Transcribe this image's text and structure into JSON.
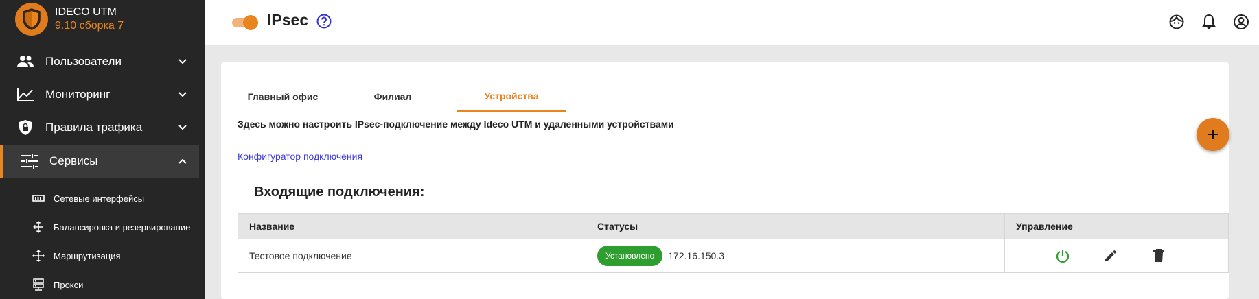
{
  "brand": {
    "name": "IDECO UTM",
    "version": "9.10 сборка 7",
    "accent": "#e8851f"
  },
  "sidebar": {
    "items": [
      {
        "label": "Пользователи",
        "icon": "users-icon",
        "expanded": false
      },
      {
        "label": "Мониторинг",
        "icon": "chart-line-icon",
        "expanded": false
      },
      {
        "label": "Правила трафика",
        "icon": "shield-lock-icon",
        "expanded": false
      },
      {
        "label": "Сервисы",
        "icon": "tune-icon",
        "expanded": true,
        "active": true
      }
    ],
    "subitems": [
      {
        "label": "Сетевые интерфейсы",
        "icon": "network-card-icon"
      },
      {
        "label": "Балансировка и резервирование",
        "icon": "arrows-split-icon"
      },
      {
        "label": "Маршрутизация",
        "icon": "arrows-move-icon"
      },
      {
        "label": "Прокси",
        "icon": "server-icon"
      }
    ]
  },
  "header": {
    "title": "IPsec",
    "enabled": true
  },
  "tabs": [
    {
      "label": "Главный офис",
      "active": false
    },
    {
      "label": "Филиал",
      "active": false
    },
    {
      "label": "Устройства",
      "active": true
    }
  ],
  "main": {
    "description": "Здесь можно настроить IPsec-подключение между Ideco UTM и удаленными устройствами",
    "config_link": "Конфигуратор подключения",
    "section_title": "Входящие подключения:",
    "table": {
      "headers": [
        "Название",
        "Статусы",
        "Управление"
      ],
      "rows": [
        {
          "name": "Тестовое подключение",
          "status": "Установлено",
          "ip": "172.16.150.3",
          "status_color": "#2e9e2e"
        }
      ]
    }
  }
}
